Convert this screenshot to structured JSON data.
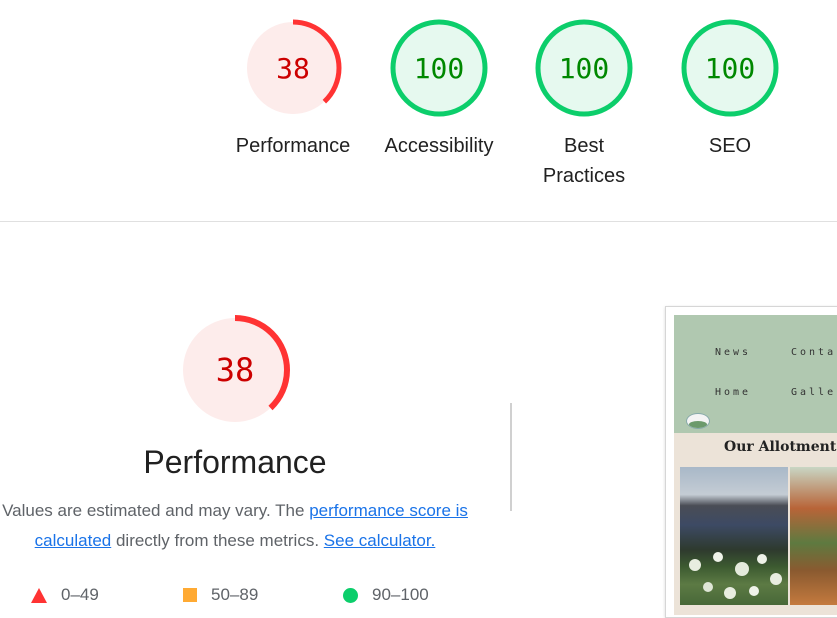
{
  "colors": {
    "fail": "#ff3333",
    "fail_bg": "#fdeceb",
    "pass": "#0cce6b",
    "pass_bg": "#e6f9ef",
    "fail_text": "#cc0000",
    "pass_text": "#008800",
    "link": "#1a73e8"
  },
  "gauges": [
    {
      "label": "Performance",
      "score": "38",
      "value": 38
    },
    {
      "label": "Accessibility",
      "score": "100",
      "value": 100
    },
    {
      "label": "Best Practices",
      "score": "100",
      "value": 100
    },
    {
      "label": "SEO",
      "score": "100",
      "value": 100
    }
  ],
  "performance": {
    "score": "38",
    "value": 38,
    "title": "Performance",
    "desc_prefix": "Values are estimated and may vary. The ",
    "link_score": "performance score is calculated",
    "desc_middle": " directly from these metrics. ",
    "link_calculator": "See calculator."
  },
  "legend": [
    {
      "icon": "triangle-icon",
      "range": "0–49"
    },
    {
      "icon": "square-icon",
      "range": "50–89"
    },
    {
      "icon": "circle-icon",
      "range": "90–100"
    }
  ],
  "screenshot": {
    "nav": [
      "News",
      "Conta",
      "Home",
      "Galle"
    ],
    "title": "Our Allotment"
  }
}
